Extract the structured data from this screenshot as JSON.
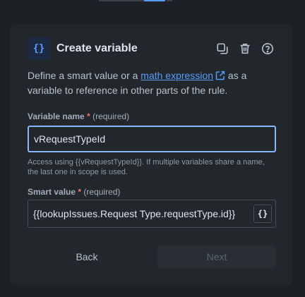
{
  "colors": {
    "accent": "#579dff",
    "panel": "#22272b",
    "background": "#1d2125",
    "required": "#f87168"
  },
  "header": {
    "icon": "curly-braces-icon",
    "title": "Create variable",
    "actions": [
      "duplicate-icon",
      "trash-icon",
      "help-icon"
    ]
  },
  "description": {
    "before": "Define a smart value or a ",
    "link": "math expression",
    "after": " as a variable to reference in other parts of the rule."
  },
  "variable_name": {
    "label": "Variable name",
    "required_mark": "*",
    "required_text": "(required)",
    "value": "vRequestTypeId",
    "help": "Access using {{vRequestTypeId}}. If multiple variables share a name, the last one in scope is used."
  },
  "smart_value": {
    "label": "Smart value",
    "required_mark": "*",
    "required_text": "(required)",
    "value": "{{lookupIssues.Request Type.requestType.id}}",
    "insert_button": "{}"
  },
  "footer": {
    "back_label": "Back",
    "next_label": "Next"
  }
}
